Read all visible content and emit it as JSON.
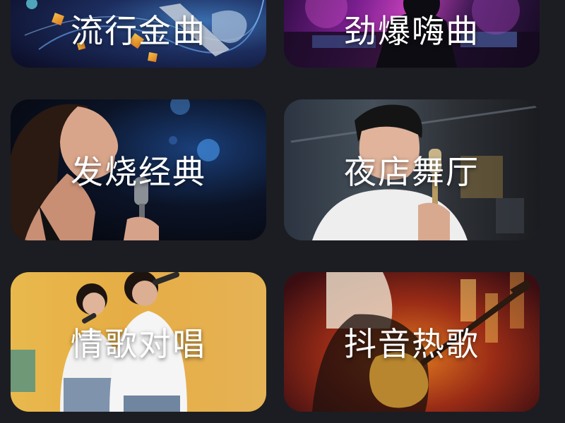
{
  "categories": [
    {
      "label": "流行金曲"
    },
    {
      "label": "劲爆嗨曲"
    },
    {
      "label": "发烧经典"
    },
    {
      "label": "夜店舞厅"
    },
    {
      "label": "情歌对唱"
    },
    {
      "label": "抖音热歌"
    }
  ],
  "colors": {
    "page_background": "#1c1d22",
    "label_text": "#ffffff"
  }
}
